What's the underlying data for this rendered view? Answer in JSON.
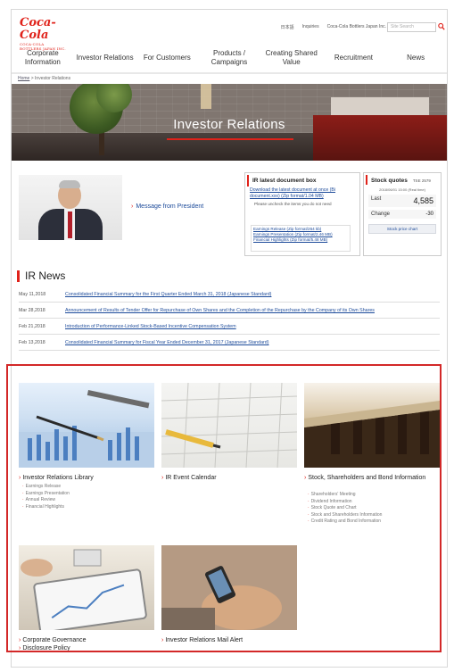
{
  "header": {
    "logo_text": "Coca-Cola",
    "logo_tagline": "COCA-COLA BOTTLERS JAPAN INC.",
    "top_links": [
      "日本語",
      "Inquiries",
      "Coca-Cola Bottlers Japan Inc."
    ],
    "search_placeholder": "Site Search"
  },
  "nav": {
    "items": [
      "Corporate Information",
      "Investor Relations",
      "For Customers",
      "Products / Campaigns",
      "Creating Shared Value",
      "Recruitment",
      "News"
    ]
  },
  "breadcrumb": {
    "home": "Home",
    "sep": ">",
    "current": "Investor Relations"
  },
  "hero": {
    "title": "Investor Relations"
  },
  "president": {
    "link_label": "Message from President"
  },
  "doc_box": {
    "title": "IR latest document box",
    "download_text": "Download the latest document at once (Bi document.xxx) (Zip format/1.04 MB)",
    "note": "Please uncheck the items you do not need",
    "items": [
      "Earnings Release (Zip format/264 kb)",
      "Earnings Presentation (Zip format/2.46 MB)",
      "Financial Highlights (Zip format/5.48 MB)"
    ]
  },
  "stock": {
    "title": "Stock quotes",
    "code": "TSE 2579",
    "datetime": "2018/06/01 15:00 (Real time)",
    "last_label": "Last",
    "last_value": "4,585",
    "change_label": "Change",
    "change_value": "-30",
    "button_label": "Stock price chart"
  },
  "news": {
    "title": "IR News",
    "items": [
      {
        "date": "May 11,2018",
        "text": "Consolidated Financial Summary for the First Quarter Ended March 31, 2018 (Japanese Standard)"
      },
      {
        "date": "Mar 28,2018",
        "text": "Announcement of Results of Tender Offer for Repurchase of Own Shares and the Completion of the Repurchase by the Company of its Own Shares"
      },
      {
        "date": "Feb 21,2018",
        "text": "Introduction of Performance-Linked Stock-Based Incentive Compensation System"
      },
      {
        "date": "Feb 13,2018",
        "text": "Consolidated Financial Summary for Fiscal Year Ended December 31, 2017 (Japanese Standard)"
      }
    ]
  },
  "tiles": {
    "library": {
      "title": "Investor Relations Library",
      "subs": [
        "Earnings Release",
        "Earnings Presentation",
        "Annual Review",
        "Financial Highlights"
      ]
    },
    "calendar": {
      "title": "IR Event Calendar"
    },
    "stock": {
      "title": "Stock, Shareholders and Bond Information",
      "subs": [
        "Shareholders' Meeting",
        "Dividend Information",
        "Stock Quote and Chart",
        "Stock and Shareholders Information",
        "Credit Rating and Bond Information"
      ]
    },
    "governance": {
      "title": "Corporate Governance",
      "title2": "Disclosure Policy"
    },
    "mail": {
      "title": "Investor Relations Mail Alert"
    }
  },
  "colors": {
    "brand_red": "#e0221a",
    "link_blue": "#1d4b9a",
    "highlight_frame": "#d32828"
  }
}
